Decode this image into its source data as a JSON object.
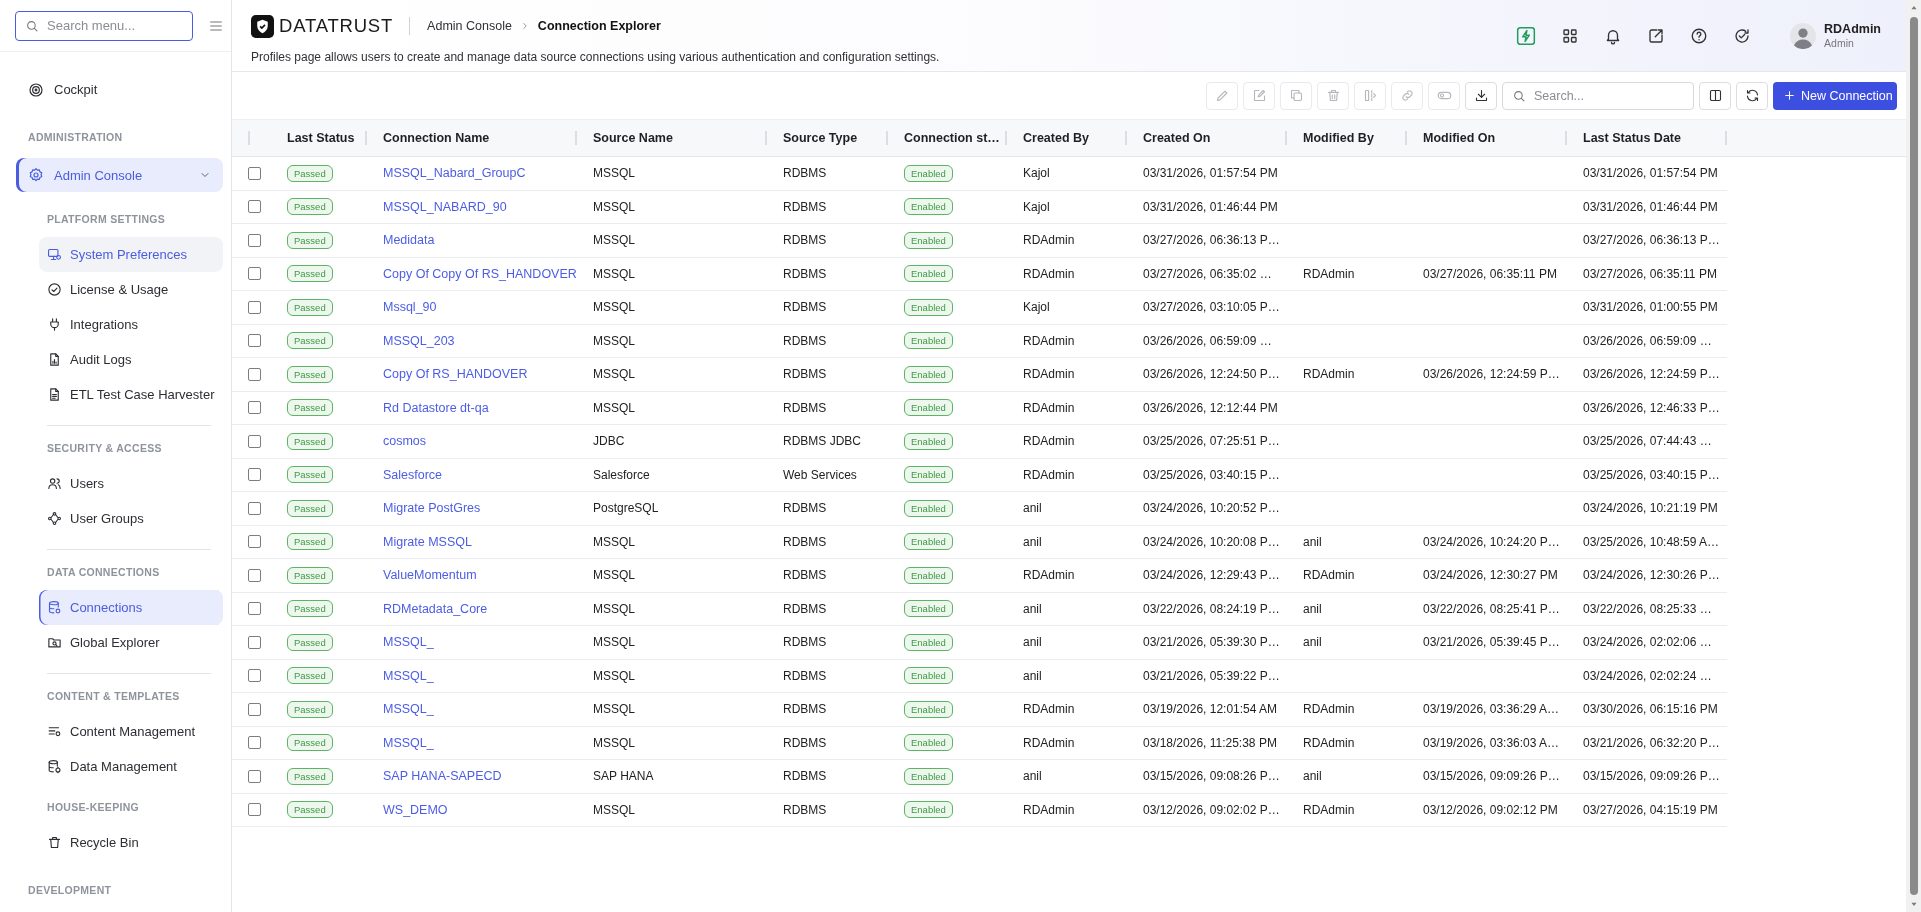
{
  "sidebar": {
    "search": {
      "placeholder": "Search menu..."
    },
    "top_item": {
      "label": "Cockpit",
      "selected": false
    },
    "sections": [
      {
        "title": "ADMINISTRATION",
        "group": {
          "label": "Admin Console",
          "selected": true,
          "expanded": true,
          "subsections": [
            {
              "title": "PLATFORM SETTINGS",
              "separated": false,
              "items": [
                {
                  "kind": "preferences",
                  "label": "System Preferences",
                  "selected": false,
                  "hovered": true
                },
                {
                  "kind": "license",
                  "label": "License & Usage",
                  "selected": false,
                  "hovered": false
                },
                {
                  "kind": "integrations",
                  "label": "Integrations",
                  "selected": false,
                  "hovered": false
                },
                {
                  "kind": "audit",
                  "label": "Audit Logs",
                  "selected": false,
                  "hovered": false
                },
                {
                  "kind": "harvester",
                  "label": "ETL Test Case Harvester",
                  "selected": false,
                  "hovered": false
                }
              ]
            },
            {
              "title": "SECURITY & ACCESS",
              "separated": true,
              "items": [
                {
                  "kind": "users",
                  "label": "Users",
                  "selected": false,
                  "hovered": false
                },
                {
                  "kind": "groups",
                  "label": "User Groups",
                  "selected": false,
                  "hovered": false
                }
              ]
            },
            {
              "title": "DATA CONNECTIONS",
              "separated": true,
              "items": [
                {
                  "kind": "connections",
                  "label": "Connections",
                  "selected": true,
                  "hovered": false
                },
                {
                  "kind": "explorer",
                  "label": "Global Explorer",
                  "selected": false,
                  "hovered": false
                }
              ]
            },
            {
              "title": "CONTENT & TEMPLATES",
              "separated": true,
              "items": [
                {
                  "kind": "content",
                  "label": "Content Management",
                  "selected": false,
                  "hovered": false
                },
                {
                  "kind": "data",
                  "label": "Data Management",
                  "selected": false,
                  "hovered": false
                }
              ]
            },
            {
              "title": "HOUSE-KEEPING",
              "separated": false,
              "items": [
                {
                  "kind": "recycle",
                  "label": "Recycle Bin",
                  "selected": false,
                  "hovered": false
                }
              ]
            }
          ]
        }
      },
      {
        "title": "DEVELOPMENT"
      }
    ]
  },
  "header": {
    "logo": "DATATRUST",
    "breadcrumb": [
      {
        "label": "Admin Console",
        "current": false
      },
      {
        "label": "Connection Explorer",
        "current": true
      }
    ],
    "description": "Profiles page allows users to create and manage data source connections using various authentication and configuration settings.",
    "user": {
      "name": "RDAdmin",
      "role": "Admin"
    }
  },
  "toolbar": {
    "actions": [
      {
        "kind": "edit",
        "disabled": true
      },
      {
        "kind": "rename",
        "disabled": true
      },
      {
        "kind": "copy",
        "disabled": true
      },
      {
        "kind": "delete",
        "disabled": true
      },
      {
        "kind": "compare",
        "disabled": true
      },
      {
        "kind": "link",
        "disabled": true
      },
      {
        "kind": "toggle",
        "disabled": true
      },
      {
        "kind": "download",
        "disabled": false
      }
    ],
    "search": {
      "placeholder": "Search..."
    },
    "new_button": "New Connection"
  },
  "table": {
    "columns": [
      "Last Status",
      "Connection Name",
      "Source Name",
      "Source Type",
      "Connection st…",
      "Created By",
      "Created On",
      "Modified By",
      "Modified On",
      "Last Status Date"
    ],
    "rows": [
      {
        "checked": false,
        "last_status": "Passed",
        "connection_name": "MSSQL_Nabard_GroupC",
        "source_name": "MSSQL",
        "source_type": "RDBMS",
        "connection_status": "Enabled",
        "created_by": "Kajol",
        "created_on": "03/31/2026, 01:57:54 PM",
        "last_status_date": "03/31/2026, 01:57:54 PM"
      },
      {
        "checked": false,
        "last_status": "Passed",
        "connection_name": "MSSQL_NABARD_90",
        "source_name": "MSSQL",
        "source_type": "RDBMS",
        "connection_status": "Enabled",
        "created_by": "Kajol",
        "created_on": "03/31/2026, 01:46:44 PM",
        "last_status_date": "03/31/2026, 01:46:44 PM"
      },
      {
        "checked": false,
        "last_status": "Passed",
        "connection_name": "Medidata",
        "source_name": "MSSQL",
        "source_type": "RDBMS",
        "connection_status": "Enabled",
        "created_by": "RDAdmin",
        "created_on": "03/27/2026, 06:36:13 P…",
        "last_status_date": "03/27/2026, 06:36:13 P…"
      },
      {
        "checked": false,
        "last_status": "Passed",
        "connection_name": "Copy Of Copy Of RS_HANDOVER",
        "source_name": "MSSQL",
        "source_type": "RDBMS",
        "connection_status": "Enabled",
        "created_by": "RDAdmin",
        "created_on": "03/27/2026, 06:35:02 …",
        "modified_by": "RDAdmin",
        "modified_on": "03/27/2026, 06:35:11 PM",
        "last_status_date": "03/27/2026, 06:35:11 PM"
      },
      {
        "checked": false,
        "last_status": "Passed",
        "connection_name": "Mssql_90",
        "source_name": "MSSQL",
        "source_type": "RDBMS",
        "connection_status": "Enabled",
        "created_by": "Kajol",
        "created_on": "03/27/2026, 03:10:05 P…",
        "last_status_date": "03/31/2026, 01:00:55 PM"
      },
      {
        "checked": false,
        "last_status": "Passed",
        "connection_name": "MSSQL_203",
        "source_name": "MSSQL",
        "source_type": "RDBMS",
        "connection_status": "Enabled",
        "created_by": "RDAdmin",
        "created_on": "03/26/2026, 06:59:09 …",
        "last_status_date": "03/26/2026, 06:59:09 …"
      },
      {
        "checked": false,
        "last_status": "Passed",
        "connection_name": "Copy Of RS_HANDOVER",
        "source_name": "MSSQL",
        "source_type": "RDBMS",
        "connection_status": "Enabled",
        "created_by": "RDAdmin",
        "created_on": "03/26/2026, 12:24:50 P…",
        "modified_by": "RDAdmin",
        "modified_on": "03/26/2026, 12:24:59 P…",
        "last_status_date": "03/26/2026, 12:24:59 P…"
      },
      {
        "checked": false,
        "last_status": "Passed",
        "connection_name": "Rd Datastore dt-qa",
        "source_name": "MSSQL",
        "source_type": "RDBMS",
        "connection_status": "Enabled",
        "created_by": "RDAdmin",
        "created_on": "03/26/2026, 12:12:44 PM",
        "last_status_date": "03/26/2026, 12:46:33 P…"
      },
      {
        "checked": false,
        "last_status": "Passed",
        "connection_name": "cosmos",
        "source_name": "JDBC",
        "source_type": "RDBMS JDBC",
        "connection_status": "Enabled",
        "created_by": "RDAdmin",
        "created_on": "03/25/2026, 07:25:51 P…",
        "last_status_date": "03/25/2026, 07:44:43 …"
      },
      {
        "checked": false,
        "last_status": "Passed",
        "connection_name": "Salesforce",
        "source_name": "Salesforce",
        "source_type": "Web Services",
        "connection_status": "Enabled",
        "created_by": "RDAdmin",
        "created_on": "03/25/2026, 03:40:15 P…",
        "last_status_date": "03/25/2026, 03:40:15 P…"
      },
      {
        "checked": false,
        "last_status": "Passed",
        "connection_name": "Migrate PostGres",
        "source_name": "PostgreSQL",
        "source_type": "RDBMS",
        "connection_status": "Enabled",
        "created_by": "anil",
        "created_on": "03/24/2026, 10:20:52 P…",
        "last_status_date": "03/24/2026, 10:21:19 PM"
      },
      {
        "checked": false,
        "last_status": "Passed",
        "connection_name": "Migrate MSSQL",
        "source_name": "MSSQL",
        "source_type": "RDBMS",
        "connection_status": "Enabled",
        "created_by": "anil",
        "created_on": "03/24/2026, 10:20:08 P…",
        "modified_by": "anil",
        "modified_on": "03/24/2026, 10:24:20 P…",
        "last_status_date": "03/25/2026, 10:48:59 A…"
      },
      {
        "checked": false,
        "last_status": "Passed",
        "connection_name": "ValueMomentum",
        "source_name": "MSSQL",
        "source_type": "RDBMS",
        "connection_status": "Enabled",
        "created_by": "RDAdmin",
        "created_on": "03/24/2026, 12:29:43 P…",
        "modified_by": "RDAdmin",
        "modified_on": "03/24/2026, 12:30:27 PM",
        "last_status_date": "03/24/2026, 12:30:26 P…"
      },
      {
        "checked": false,
        "last_status": "Passed",
        "connection_name": "RDMetadata_Core",
        "source_name": "MSSQL",
        "source_type": "RDBMS",
        "connection_status": "Enabled",
        "created_by": "anil",
        "created_on": "03/22/2026, 08:24:19 P…",
        "modified_by": "anil",
        "modified_on": "03/22/2026, 08:25:41 P…",
        "last_status_date": "03/22/2026, 08:25:33 …"
      },
      {
        "checked": false,
        "last_status": "Passed",
        "connection_name": "MSSQL_",
        "source_name": "MSSQL",
        "source_type": "RDBMS",
        "connection_status": "Enabled",
        "created_by": "anil",
        "created_on": "03/21/2026, 05:39:30 P…",
        "modified_by": "anil",
        "modified_on": "03/21/2026, 05:39:45 P…",
        "last_status_date": "03/24/2026, 02:02:06 …"
      },
      {
        "checked": false,
        "last_status": "Passed",
        "connection_name": "MSSQL_",
        "source_name": "MSSQL",
        "source_type": "RDBMS",
        "connection_status": "Enabled",
        "created_by": "anil",
        "created_on": "03/21/2026, 05:39:22 P…",
        "last_status_date": "03/24/2026, 02:02:24 …"
      },
      {
        "checked": false,
        "last_status": "Passed",
        "connection_name": "MSSQL_",
        "source_name": "MSSQL",
        "source_type": "RDBMS",
        "connection_status": "Enabled",
        "created_by": "RDAdmin",
        "created_on": "03/19/2026, 12:01:54 AM",
        "modified_by": "RDAdmin",
        "modified_on": "03/19/2026, 03:36:29 A…",
        "last_status_date": "03/30/2026, 06:15:16 PM"
      },
      {
        "checked": false,
        "last_status": "Passed",
        "connection_name": "MSSQL_",
        "source_name": "MSSQL",
        "source_type": "RDBMS",
        "connection_status": "Enabled",
        "created_by": "RDAdmin",
        "created_on": "03/18/2026, 11:25:38 PM",
        "modified_by": "RDAdmin",
        "modified_on": "03/19/2026, 03:36:03 A…",
        "last_status_date": "03/21/2026, 06:32:20 P…"
      },
      {
        "checked": false,
        "last_status": "Passed",
        "connection_name": "SAP HANA-SAPECD",
        "source_name": "SAP HANA",
        "source_type": "RDBMS",
        "connection_status": "Enabled",
        "created_by": "anil",
        "created_on": "03/15/2026, 09:08:26 P…",
        "modified_by": "anil",
        "modified_on": "03/15/2026, 09:09:26 P…",
        "last_status_date": "03/15/2026, 09:09:26 P…"
      },
      {
        "checked": false,
        "last_status": "Passed",
        "connection_name": "WS_DEMO",
        "source_name": "MSSQL",
        "source_type": "RDBMS",
        "connection_status": "Enabled",
        "created_by": "RDAdmin",
        "created_on": "03/12/2026, 09:02:02 P…",
        "modified_by": "RDAdmin",
        "modified_on": "03/12/2026, 09:02:12 PM",
        "last_status_date": "03/27/2026, 04:15:19 PM"
      }
    ]
  }
}
